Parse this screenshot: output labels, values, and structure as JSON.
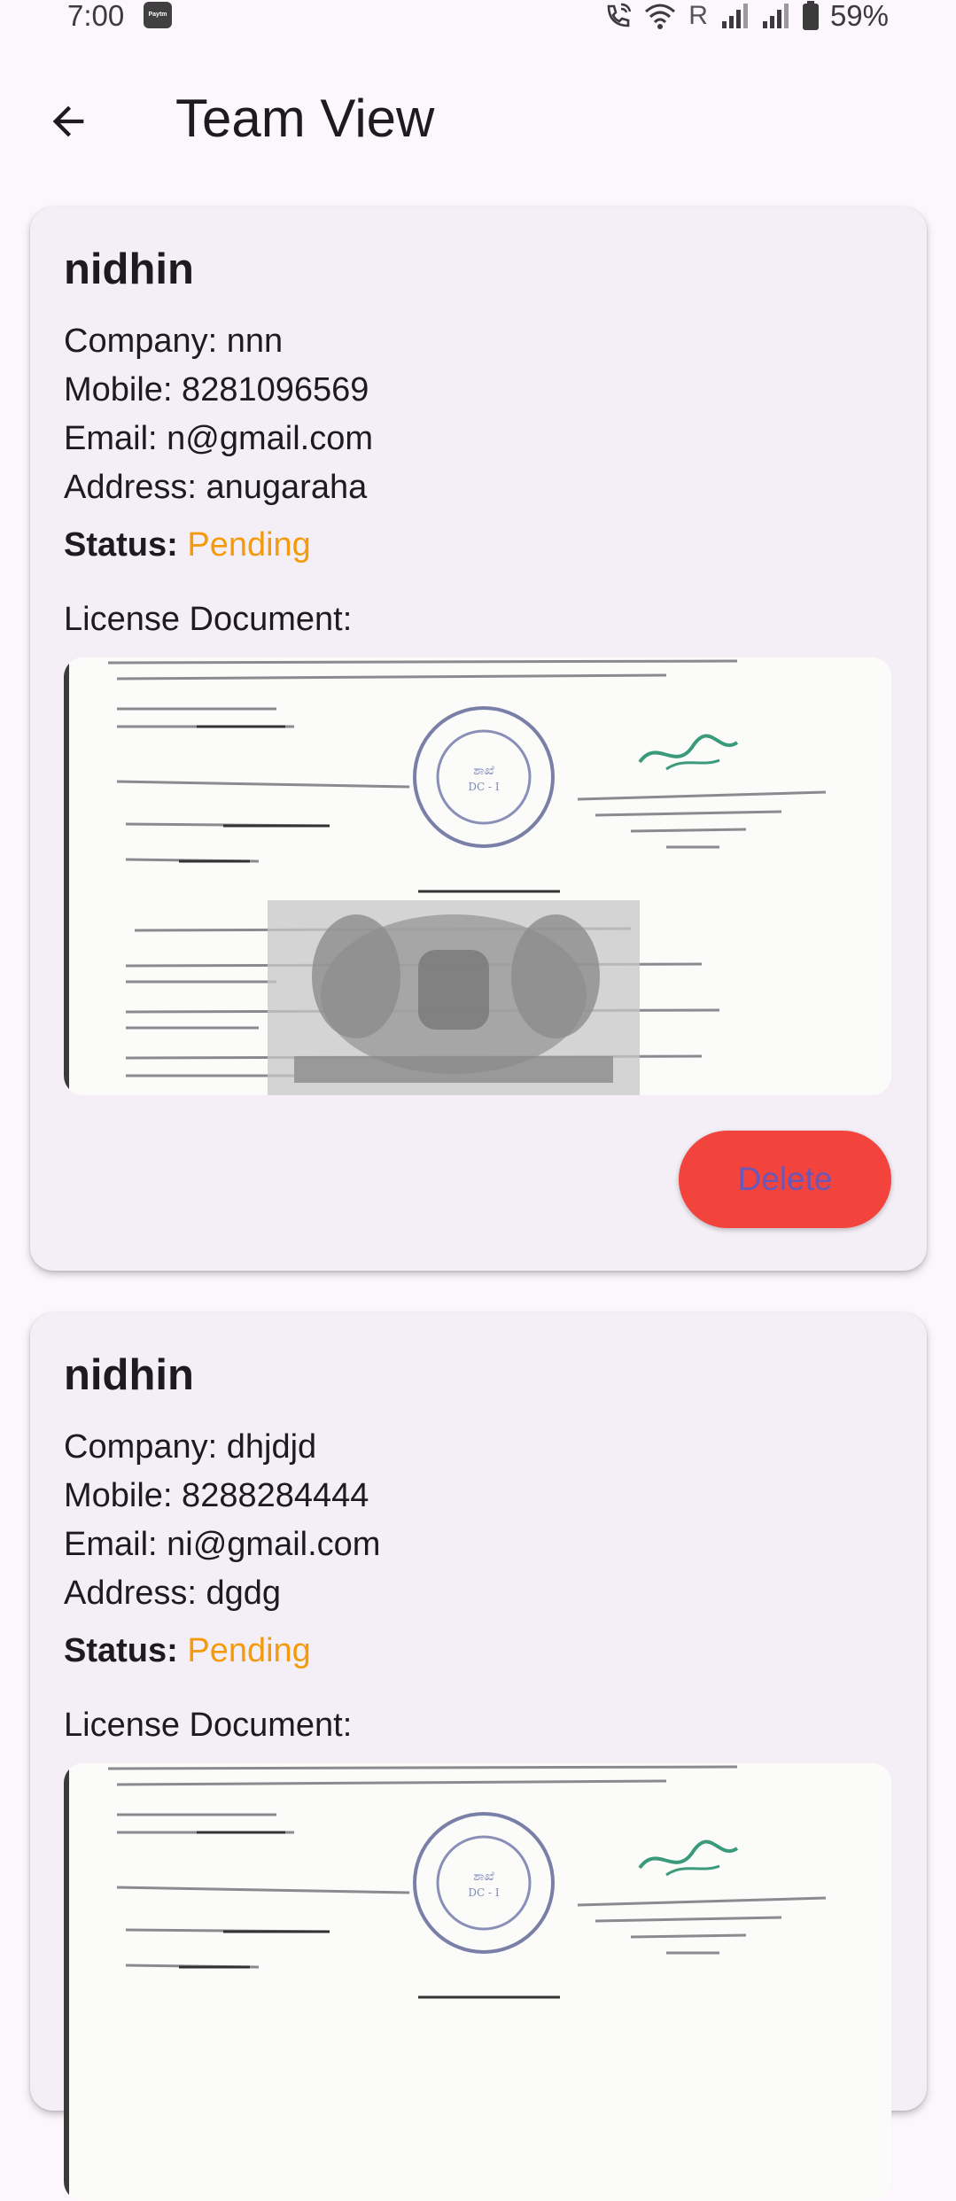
{
  "status_bar": {
    "time": "7:00",
    "app_icon_label": "Paytm",
    "roaming_indicator": "R",
    "battery_percent": "59%"
  },
  "app_bar": {
    "title": "Team View",
    "back_icon": "arrow-back-icon"
  },
  "members": [
    {
      "name": "nidhin",
      "company": "Company: nnn",
      "mobile": "Mobile: 8281096569",
      "email": "Email: n@gmail.com",
      "address": "Address: anugaraha",
      "status_label": "Status:",
      "status_value": "Pending",
      "license_label": "License Document:",
      "delete_label": "Delete"
    },
    {
      "name": "nidhin",
      "company": "Company: dhjdjd",
      "mobile": "Mobile: 8288284444",
      "email": "Email: ni@gmail.com",
      "address": "Address: dgdg",
      "status_label": "Status:",
      "status_value": "Pending",
      "license_label": "License Document:"
    }
  ],
  "colors": {
    "background": "#fcf7fc",
    "card": "#f4eff6",
    "status_pending": "#f59a0c",
    "delete_button": "#f2433c",
    "delete_text": "#6a58b8"
  }
}
